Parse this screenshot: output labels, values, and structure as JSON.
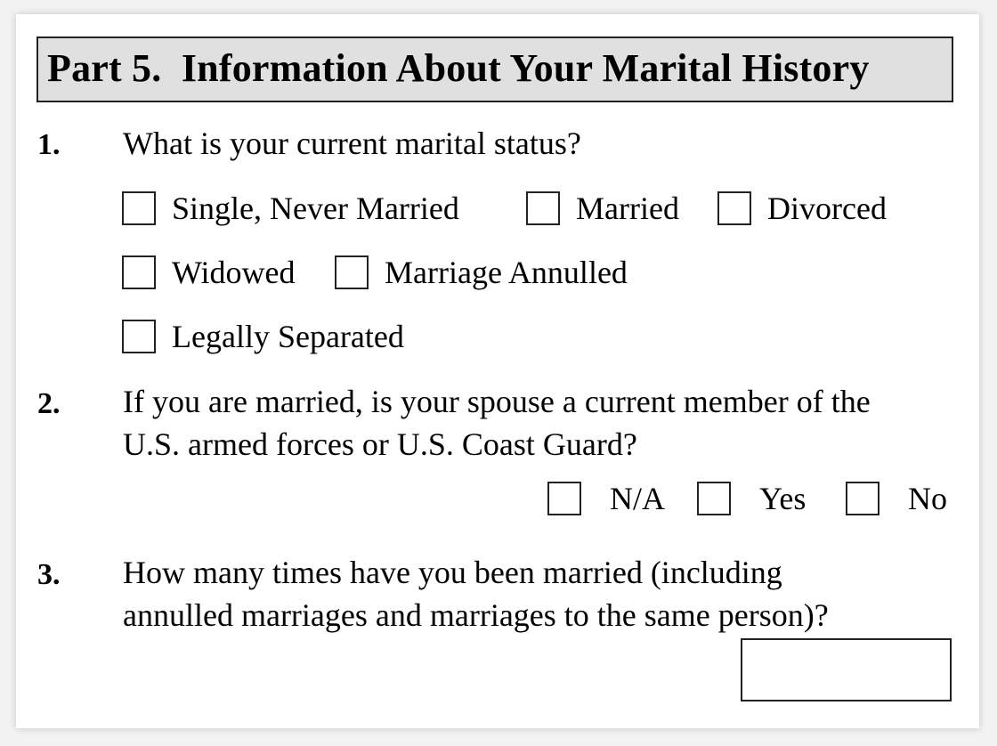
{
  "header": {
    "title": "Part 5.  Information About Your Marital History"
  },
  "questions": [
    {
      "number": "1.",
      "text_lines": [
        "What is your current marital status?"
      ],
      "options": [
        {
          "label": "Single, Never Married",
          "checked": false
        },
        {
          "label": "Married",
          "checked": false
        },
        {
          "label": "Divorced",
          "checked": false
        },
        {
          "label": "Widowed",
          "checked": false
        },
        {
          "label": "Marriage Annulled",
          "checked": false
        },
        {
          "label": "Legally Separated",
          "checked": false
        }
      ]
    },
    {
      "number": "2.",
      "text_lines": [
        "If you are married, is your spouse a current member of the",
        "U.S. armed forces or U.S. Coast Guard?"
      ],
      "options": [
        {
          "label": "N/A",
          "checked": false
        },
        {
          "label": "Yes",
          "checked": false
        },
        {
          "label": "No",
          "checked": false
        }
      ]
    },
    {
      "number": "3.",
      "text_lines": [
        "How many times have you been married (including",
        "annulled marriages and marriages to the same person)?"
      ],
      "answer_value": ""
    }
  ]
}
